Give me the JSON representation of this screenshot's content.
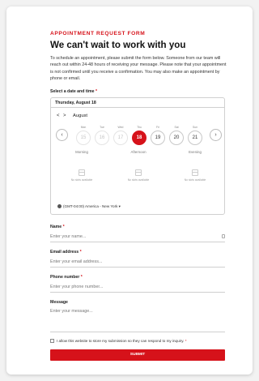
{
  "form": {
    "eyebrow": "APPOINTMENT REQUEST FORM",
    "title": "We can't wait to work with you",
    "intro": "To schedule an appointment, please submit the form below. Someone from our team will reach out within 24-48 hours of receiving your message. Please note that your appointment is not confirmed until you receive a confirmation. You may also make an appointment by phone or email."
  },
  "datetime": {
    "label": "Select a date and time",
    "required_mark": "*",
    "selected_date": "Thursday, August 18",
    "month": "August",
    "prev_month": "<",
    "next_month": ">",
    "prev_week": "‹",
    "next_week": "›",
    "days": [
      {
        "dow": "Mon",
        "num": "15",
        "state": "past"
      },
      {
        "dow": "Tue",
        "num": "16",
        "state": "past"
      },
      {
        "dow": "Wed",
        "num": "17",
        "state": "past"
      },
      {
        "dow": "Thu",
        "num": "18",
        "state": "selected"
      },
      {
        "dow": "Fri",
        "num": "19",
        "state": "available"
      },
      {
        "dow": "Sat",
        "num": "20",
        "state": "available"
      },
      {
        "dow": "Sun",
        "num": "21",
        "state": "available"
      }
    ],
    "periods": [
      "Morning",
      "Afternoon",
      "Evening"
    ],
    "no_slots": "No slots available",
    "timezone": "(GMT-04:00) America - New York ▾"
  },
  "fields": {
    "name": {
      "label": "Name",
      "placeholder": "Enter your name..."
    },
    "email": {
      "label": "Email address",
      "placeholder": "Enter your email address..."
    },
    "phone": {
      "label": "Phone number",
      "placeholder": "Enter your phone number..."
    },
    "message": {
      "label": "Message",
      "placeholder": "Enter your message..."
    }
  },
  "consent": {
    "text": "I allow this website to store my submission so they can respond to my inquiry.",
    "checked": false
  },
  "submit_label": "SUBMIT",
  "colors": {
    "accent": "#d6121a"
  }
}
